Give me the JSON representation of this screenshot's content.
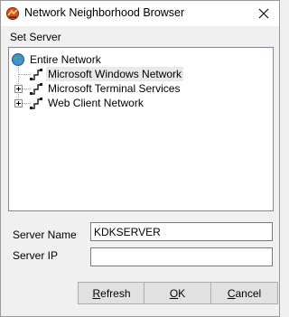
{
  "window": {
    "title": "Network Neighborhood Browser",
    "app_icon": "network-browser-icon",
    "close_icon": "close-icon"
  },
  "set_server_label": "Set Server",
  "tree": {
    "root": {
      "label": "Entire Network",
      "icon": "globe-icon"
    },
    "children": [
      {
        "label": "Microsoft Windows Network",
        "icon": "network-icon",
        "expandable": false,
        "selected": true
      },
      {
        "label": "Microsoft Terminal Services",
        "icon": "network-icon",
        "expandable": true,
        "selected": false
      },
      {
        "label": "Web Client Network",
        "icon": "network-icon",
        "expandable": true,
        "selected": false
      }
    ]
  },
  "server_name": {
    "label": "Server Name",
    "value": "KDKSERVER"
  },
  "server_ip": {
    "label": "Server IP",
    "value": ""
  },
  "buttons": {
    "refresh": {
      "first": "R",
      "rest": "efresh"
    },
    "ok": {
      "first": "O",
      "rest": "K"
    },
    "cancel": {
      "first": "C",
      "rest": "ancel"
    }
  }
}
